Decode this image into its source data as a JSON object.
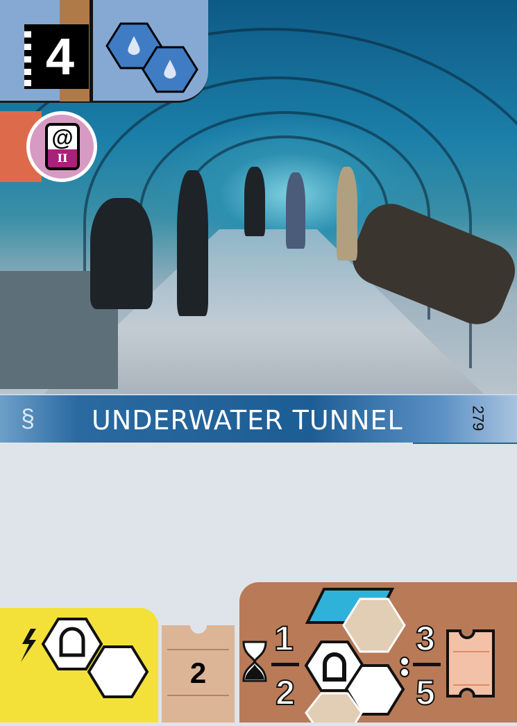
{
  "card": {
    "cost": "4",
    "title": "UNDERWATER TUNNEL",
    "number": "279",
    "level": "II",
    "badge_symbol": "@"
  },
  "requirements": [
    {
      "icon": "water-icon"
    },
    {
      "icon": "water-icon"
    }
  ],
  "bonus": {
    "icon": "lightning-icon",
    "building": "tunnel-icon"
  },
  "ticket": {
    "value": "2"
  },
  "conditions": {
    "left_top": "1",
    "left_bottom": "2",
    "right_top": "3",
    "right_bottom": "5"
  },
  "colors": {
    "requirement_panel": "#86a9d3",
    "banner": "#1d5d95",
    "yellow": "#f3e13a",
    "brown": "#b97a57",
    "level": "#a8217a"
  }
}
